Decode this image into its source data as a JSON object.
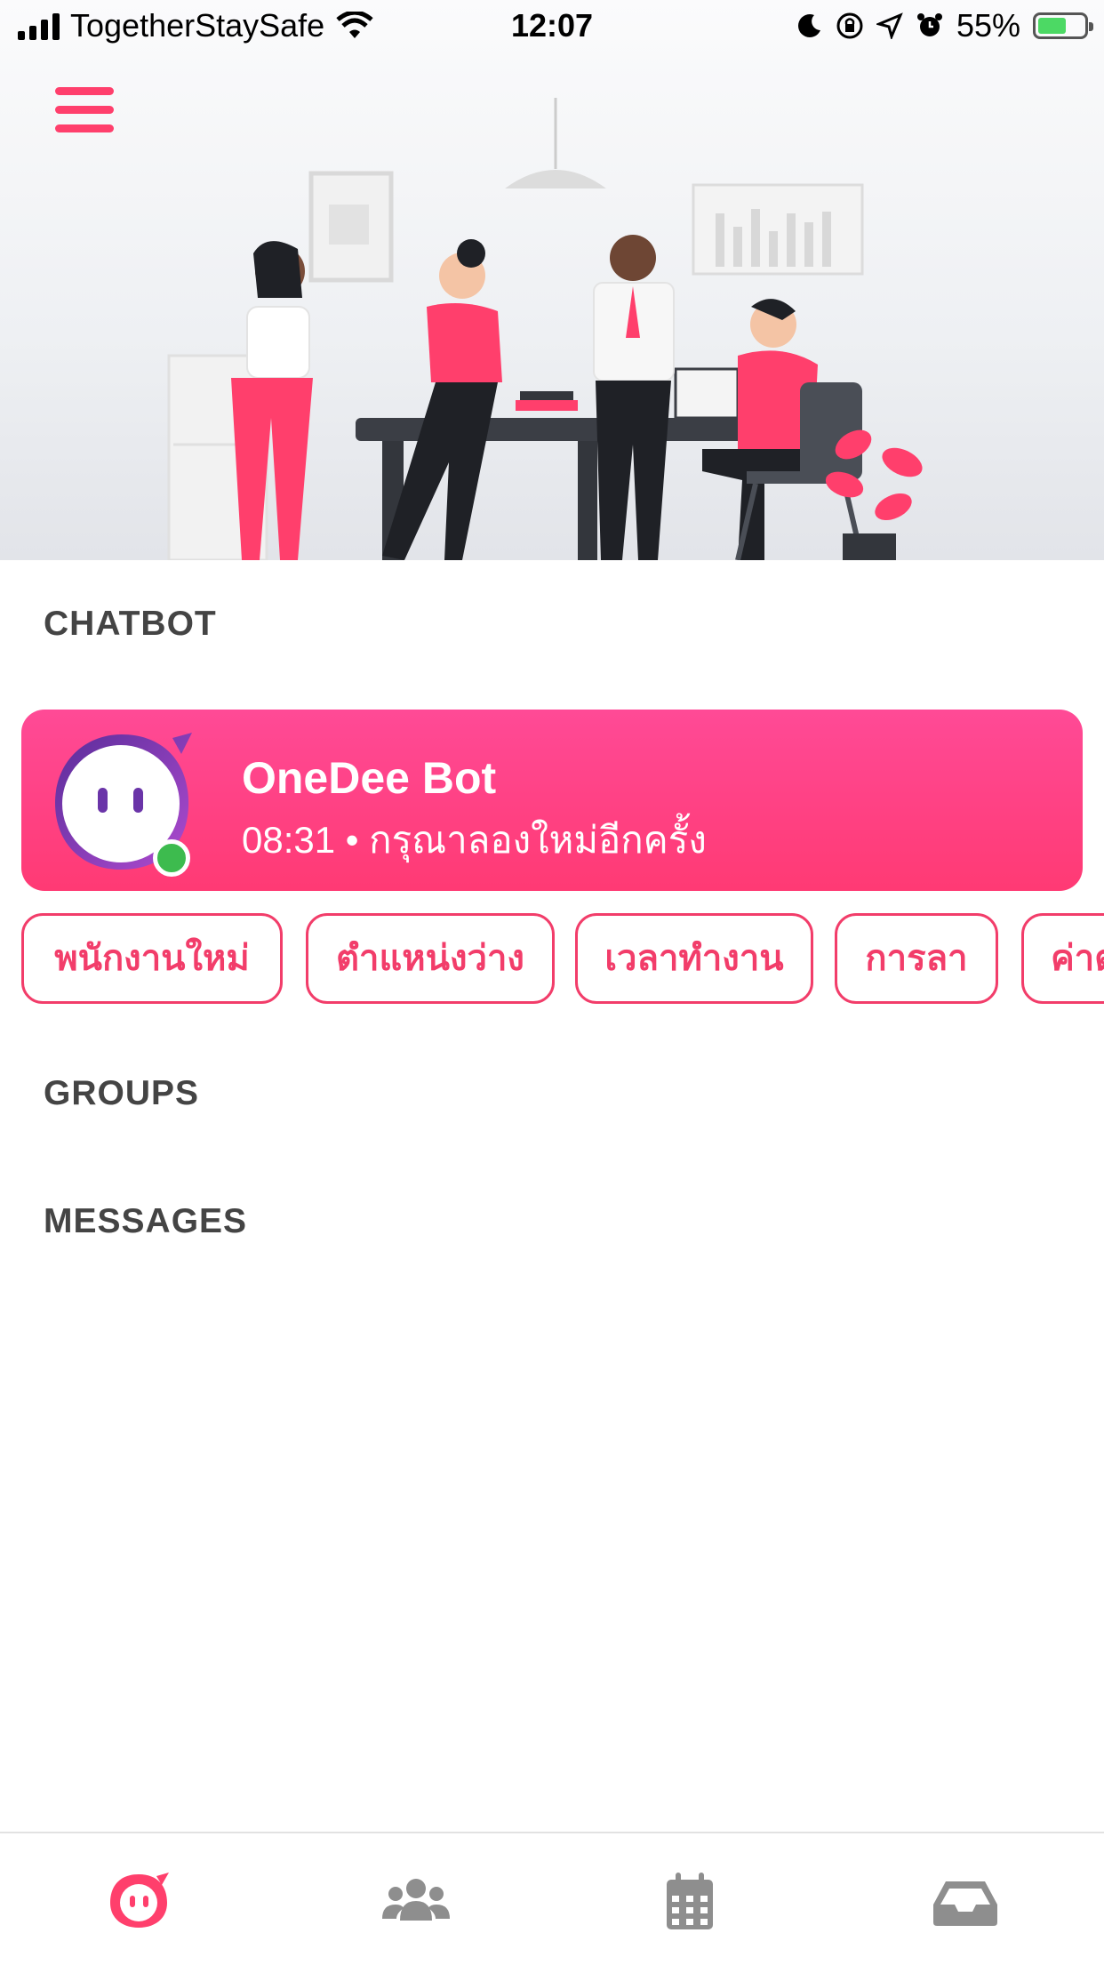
{
  "status_bar": {
    "carrier": "TogetherStaySafe",
    "time": "12:07",
    "battery_percent": "55%",
    "battery_level": 0.55,
    "icons": [
      "signal-icon",
      "wifi-icon",
      "moon-icon",
      "rotation-lock-icon",
      "location-arrow-icon",
      "alarm-icon",
      "battery-charging-icon"
    ]
  },
  "header": {
    "menu_icon": "hamburger-menu-icon",
    "illustration": "office-team-illustration"
  },
  "sections": {
    "chatbot": "CHATBOT",
    "groups": "GROUPS",
    "messages": "MESSAGES"
  },
  "bot": {
    "name": "OneDee Bot",
    "last_message": "08:31 • กรุณาลองใหม่อีกครั้ง",
    "online": true,
    "avatar_icon": "onedee-bot-avatar"
  },
  "quick_replies": [
    "พนักงานใหม่",
    "ตำแหน่งว่าง",
    "เวลาทำงาน",
    "การลา",
    "ค่าต"
  ],
  "tab_bar": {
    "tabs": [
      {
        "icon": "bot-face-icon",
        "active": true
      },
      {
        "icon": "users-icon",
        "active": false
      },
      {
        "icon": "calendar-icon",
        "active": false
      },
      {
        "icon": "inbox-icon",
        "active": false
      }
    ]
  },
  "colors": {
    "accent": "#ff3f6c",
    "card_gradient_top": "#ff4a96",
    "card_gradient_bottom": "#ff3a74",
    "online": "#3dbb4e",
    "tab_inactive": "#8e8e8e"
  }
}
